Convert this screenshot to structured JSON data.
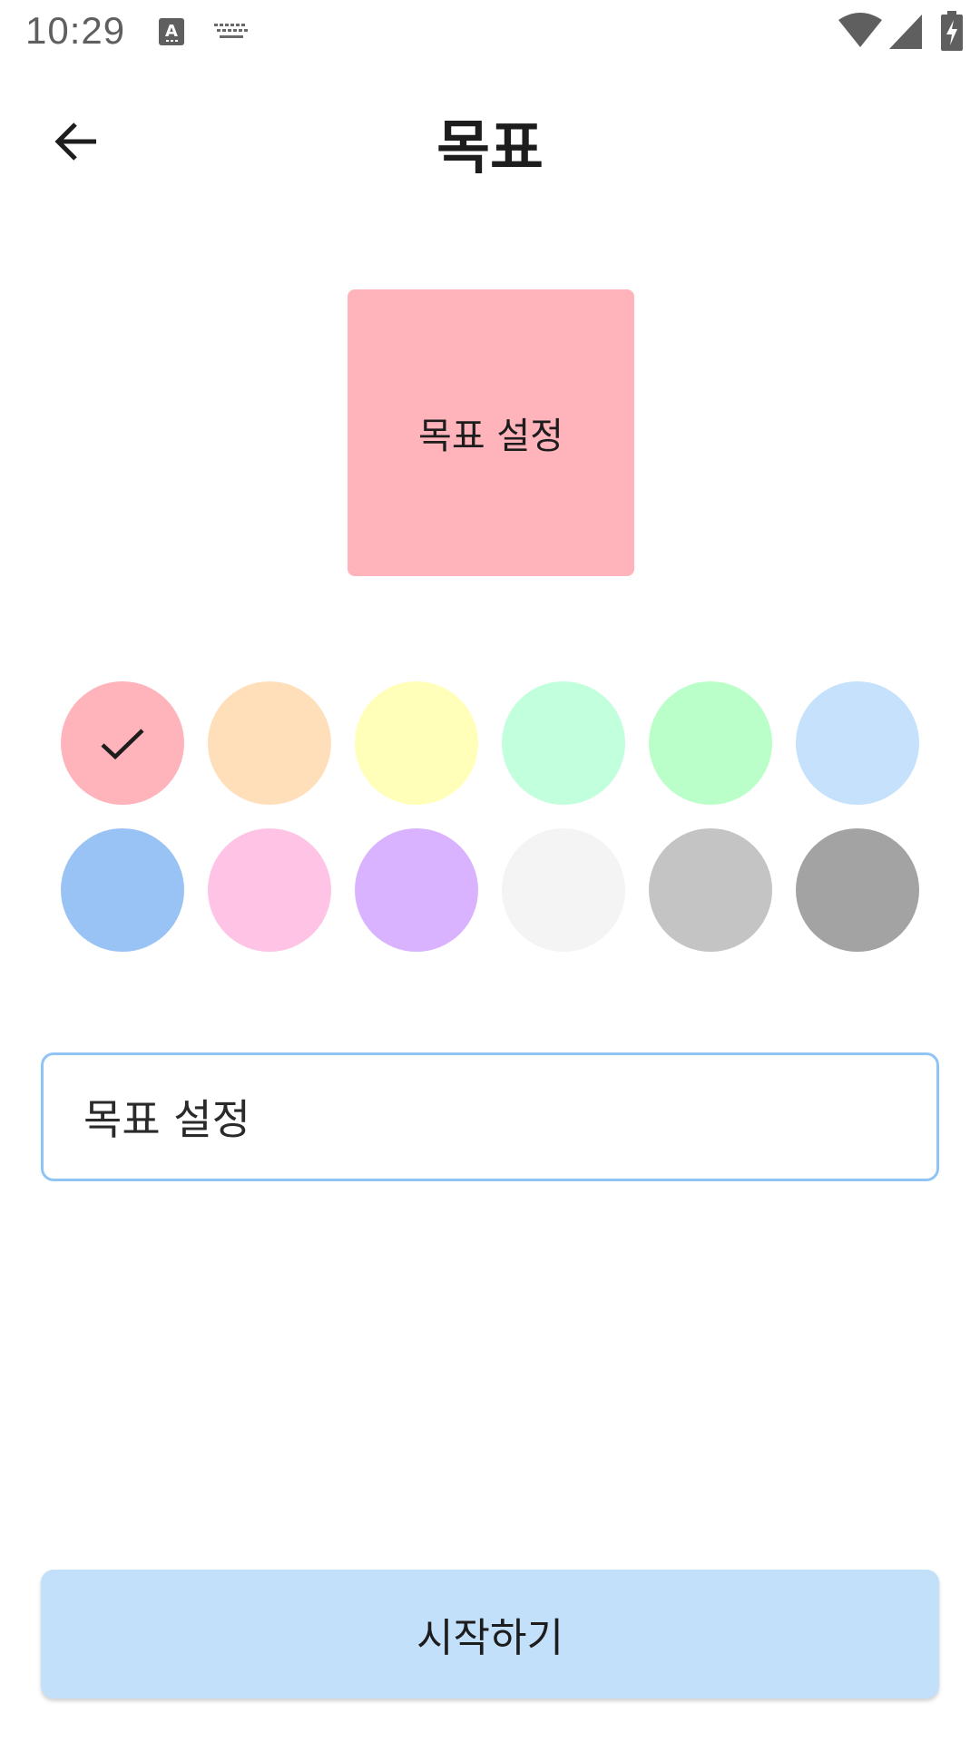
{
  "status_bar": {
    "time": "10:29",
    "icons": [
      "a-input-icon",
      "keyboard-icon",
      "wifi-icon",
      "cell-signal-icon",
      "battery-charging-icon"
    ]
  },
  "app_bar": {
    "title": "목표",
    "back_icon": "arrow-back-icon"
  },
  "preview": {
    "text": "목표 설정",
    "color": "#ffb3ba"
  },
  "palette": {
    "selected_index": 0,
    "colors": [
      "#ffb3ba",
      "#ffdfba",
      "#ffffba",
      "#c1ffdd",
      "#baffc9",
      "#c5e1fc",
      "#99c3f5",
      "#ffc3e6",
      "#d9b3ff",
      "#f4f4f4",
      "#c4c4c4",
      "#a3a3a3"
    ]
  },
  "goal_input": {
    "value": "목표 설정",
    "border_color": "#90c4f5"
  },
  "start_button": {
    "label": "시작하기",
    "color": "#c3e0fb"
  }
}
